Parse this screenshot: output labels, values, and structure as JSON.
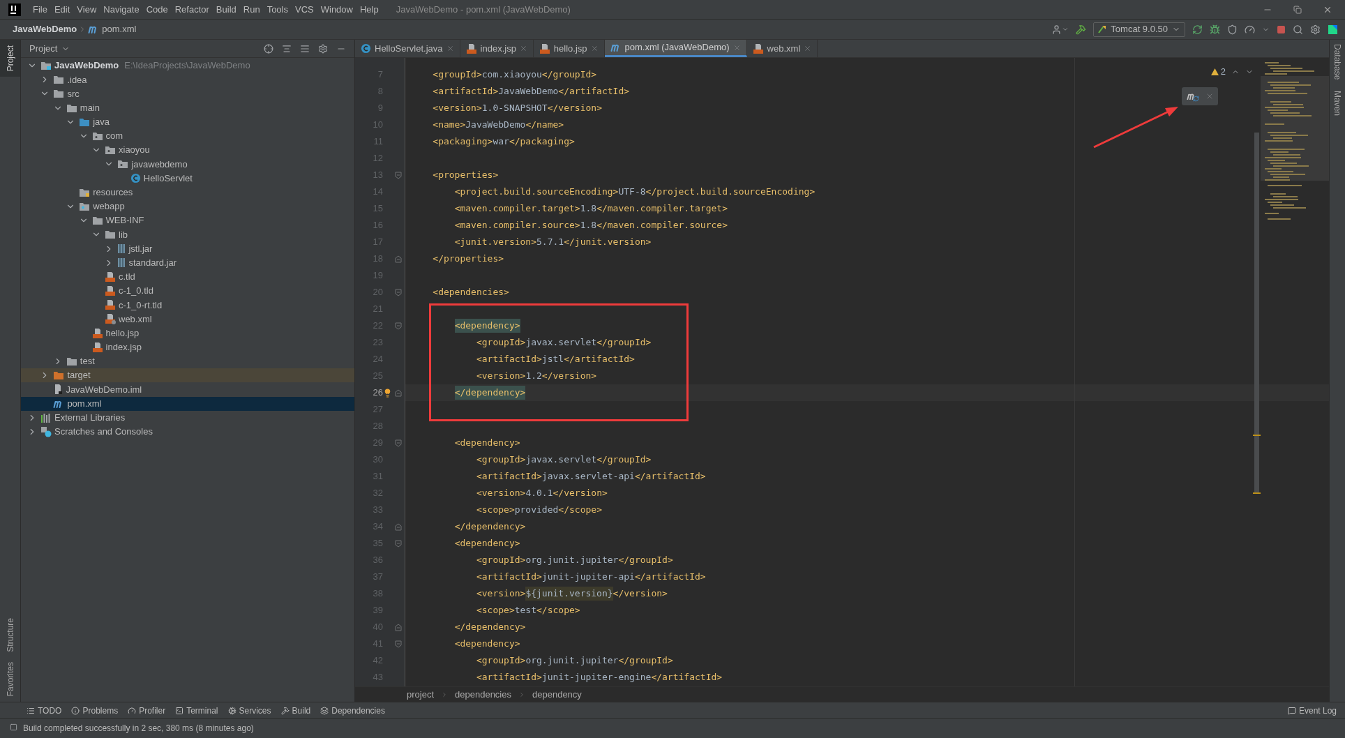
{
  "menu": [
    "File",
    "Edit",
    "View",
    "Navigate",
    "Code",
    "Refactor",
    "Build",
    "Run",
    "Tools",
    "VCS",
    "Window",
    "Help"
  ],
  "window": {
    "title": "JavaWebDemo - pom.xml (JavaWebDemo)"
  },
  "nav_breadcrumb": [
    {
      "kind": "project",
      "label": "JavaWebDemo"
    },
    {
      "kind": "maven",
      "label": "pom.xml"
    }
  ],
  "run_config": {
    "label": "Tomcat 9.0.50"
  },
  "left_strip": {
    "top": [
      {
        "label": "Project",
        "selected": true
      }
    ],
    "bottom": [
      {
        "label": "Structure",
        "selected": false
      },
      {
        "label": "Favorites",
        "selected": false
      }
    ]
  },
  "right_strip": [
    "Database",
    "Maven"
  ],
  "project_panel": {
    "title": "Project",
    "tree": [
      {
        "label": "JavaWebDemo",
        "hint": "E:\\IdeaProjects\\JavaWebDemo",
        "kind": "module",
        "expanded": true,
        "selected": false,
        "children": [
          {
            "label": ".idea",
            "kind": "folder",
            "expanded": false,
            "selected": false
          },
          {
            "label": "src",
            "kind": "folder",
            "expanded": true,
            "selected": false,
            "children": [
              {
                "label": "main",
                "kind": "folder",
                "expanded": true,
                "selected": false,
                "children": [
                  {
                    "label": "java",
                    "kind": "source",
                    "expanded": true,
                    "selected": false,
                    "children": [
                      {
                        "label": "com",
                        "kind": "package",
                        "expanded": true,
                        "selected": false,
                        "children": [
                          {
                            "label": "xiaoyou",
                            "kind": "package",
                            "expanded": true,
                            "selected": false,
                            "children": [
                              {
                                "label": "javawebdemo",
                                "kind": "package",
                                "expanded": true,
                                "selected": false,
                                "children": [
                                  {
                                    "label": "HelloServlet",
                                    "kind": "class",
                                    "selected": false
                                  }
                                ]
                              }
                            ]
                          }
                        ]
                      }
                    ]
                  },
                  {
                    "label": "resources",
                    "kind": "resources",
                    "selected": false
                  },
                  {
                    "label": "webapp",
                    "kind": "web",
                    "expanded": true,
                    "selected": false,
                    "children": [
                      {
                        "label": "WEB-INF",
                        "kind": "folder",
                        "expanded": true,
                        "selected": false,
                        "children": [
                          {
                            "label": "lib",
                            "kind": "folder",
                            "expanded": true,
                            "selected": false,
                            "children": [
                              {
                                "label": "jstl.jar",
                                "kind": "jar",
                                "expanded": false,
                                "selected": false
                              },
                              {
                                "label": "standard.jar",
                                "kind": "jar",
                                "expanded": false,
                                "selected": false
                              }
                            ]
                          },
                          {
                            "label": "c.tld",
                            "kind": "tld",
                            "selected": false
                          },
                          {
                            "label": "c-1_0.tld",
                            "kind": "tld",
                            "selected": false
                          },
                          {
                            "label": "c-1_0-rt.tld",
                            "kind": "tld",
                            "selected": false
                          },
                          {
                            "label": "web.xml",
                            "kind": "webxml",
                            "selected": false
                          }
                        ]
                      },
                      {
                        "label": "hello.jsp",
                        "kind": "jsp",
                        "selected": false
                      },
                      {
                        "label": "index.jsp",
                        "kind": "jsp",
                        "selected": false
                      }
                    ]
                  }
                ]
              },
              {
                "label": "test",
                "kind": "folder",
                "expanded": false,
                "selected": false
              }
            ]
          },
          {
            "label": "target",
            "kind": "excluded",
            "expanded": false,
            "selected": false
          },
          {
            "label": "JavaWebDemo.iml",
            "kind": "iml",
            "selected": false
          },
          {
            "label": "pom.xml",
            "kind": "maven",
            "selected": true
          }
        ]
      },
      {
        "label": "External Libraries",
        "kind": "libraries",
        "expanded": false,
        "selected": false
      },
      {
        "label": "Scratches and Consoles",
        "kind": "scratches",
        "expanded": false,
        "selected": false
      }
    ]
  },
  "tabs": [
    {
      "label": "HelloServlet.java",
      "kind": "class",
      "selected": false
    },
    {
      "label": "index.jsp",
      "kind": "jsp",
      "selected": false
    },
    {
      "label": "hello.jsp",
      "kind": "jsp",
      "selected": false
    },
    {
      "label": "pom.xml (JavaWebDemo)",
      "kind": "maven",
      "selected": true
    },
    {
      "label": "web.xml",
      "kind": "xml",
      "selected": false
    }
  ],
  "warnings": {
    "count": "2"
  },
  "code": [
    {
      "number": "7",
      "text": "    <groupId>com.xiaoyou</groupId>"
    },
    {
      "number": "8",
      "text": "    <artifactId>JavaWebDemo</artifactId>"
    },
    {
      "number": "9",
      "text": "    <version>1.0-SNAPSHOT</version>"
    },
    {
      "number": "10",
      "text": "    <name>JavaWebDemo</name>"
    },
    {
      "number": "11",
      "text": "    <packaging>war</packaging>"
    },
    {
      "number": "12"
    },
    {
      "number": "13",
      "text": "    <properties>",
      "fold": {
        "kind": "start"
      }
    },
    {
      "number": "14",
      "text": "        <project.build.sourceEncoding>UTF-8</project.build.sourceEncoding>"
    },
    {
      "number": "15",
      "text": "        <maven.compiler.target>1.8</maven.compiler.target>"
    },
    {
      "number": "16",
      "text": "        <maven.compiler.source>1.8</maven.compiler.source>"
    },
    {
      "number": "17",
      "text": "        <junit.version>5.7.1</junit.version>"
    },
    {
      "number": "18",
      "text": "    </properties>",
      "fold": {
        "kind": "end"
      }
    },
    {
      "number": "19"
    },
    {
      "number": "20",
      "text": "    <dependencies>",
      "fold": {
        "kind": "start"
      }
    },
    {
      "number": "21"
    },
    {
      "number": "22",
      "text": "        <dependency>",
      "fold": {
        "kind": "start"
      },
      "match": true
    },
    {
      "number": "23",
      "text": "            <groupId>javax.servlet</groupId>"
    },
    {
      "number": "24",
      "text": "            <artifactId>jstl</artifactId>"
    },
    {
      "number": "25",
      "text": "            <version>1.2</version>"
    },
    {
      "number": "26",
      "text": "        </dependency>",
      "fold": {
        "kind": "end"
      },
      "match": true,
      "current": true,
      "bulb": true
    },
    {
      "number": "27"
    },
    {
      "number": "28"
    },
    {
      "number": "29",
      "text": "        <dependency>",
      "fold": {
        "kind": "start"
      }
    },
    {
      "number": "30",
      "text": "            <groupId>javax.servlet</groupId>"
    },
    {
      "number": "31",
      "text": "            <artifactId>javax.servlet-api</artifactId>"
    },
    {
      "number": "32",
      "text": "            <version>4.0.1</version>"
    },
    {
      "number": "33",
      "text": "            <scope>provided</scope>"
    },
    {
      "number": "34",
      "text": "        </dependency>",
      "fold": {
        "kind": "end"
      }
    },
    {
      "number": "35",
      "text": "        <dependency>",
      "fold": {
        "kind": "start"
      }
    },
    {
      "number": "36",
      "text": "            <groupId>org.junit.jupiter</groupId>"
    },
    {
      "number": "37",
      "text": "            <artifactId>junit-jupiter-api</artifactId>"
    },
    {
      "number": "38",
      "text": "            <version>${junit.version}</version>",
      "ref": true
    },
    {
      "number": "39",
      "text": "            <scope>test</scope>"
    },
    {
      "number": "40",
      "text": "        </dependency>",
      "fold": {
        "kind": "end"
      }
    },
    {
      "number": "41",
      "text": "        <dependency>",
      "fold": {
        "kind": "start"
      }
    },
    {
      "number": "42",
      "text": "            <groupId>org.junit.jupiter</groupId>"
    },
    {
      "number": "43",
      "text": "            <artifactId>junit-jupiter-engine</artifactId>"
    }
  ],
  "annotations": {
    "box": true,
    "arrow": true
  },
  "editor_breadcrumb": [
    "project",
    "dependencies",
    "dependency"
  ],
  "tool_windows": [
    {
      "label": "TODO",
      "kind": "todo"
    },
    {
      "label": "Problems",
      "kind": "problems"
    },
    {
      "label": "Profiler",
      "kind": "profiler"
    },
    {
      "label": "Terminal",
      "kind": "terminal"
    },
    {
      "label": "Services",
      "kind": "services"
    },
    {
      "label": "Build",
      "kind": "build"
    },
    {
      "label": "Dependencies",
      "kind": "dependencies"
    }
  ],
  "event_log": {
    "label": "Event Log"
  },
  "status_bar": {
    "message": "Build completed successfully in 2 sec, 380 ms (8 minutes ago)"
  }
}
